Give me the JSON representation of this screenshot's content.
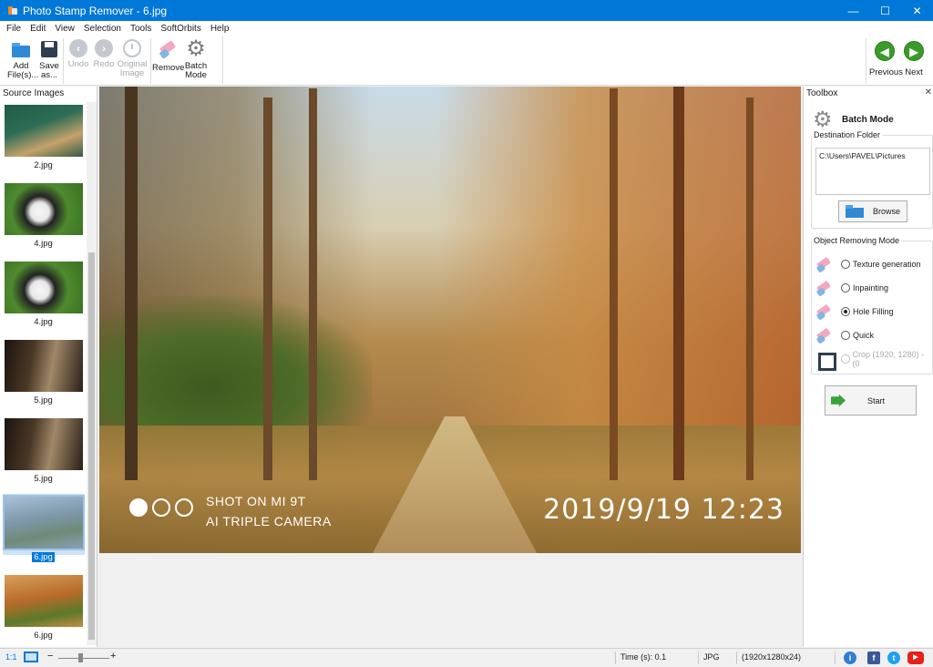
{
  "window": {
    "title": "Photo Stamp Remover - 6.jpg",
    "controls": {
      "minimize": "—",
      "maximize": "☐",
      "close": "✕"
    }
  },
  "menu": [
    "File",
    "Edit",
    "View",
    "Selection",
    "Tools",
    "SoftOrbits",
    "Help"
  ],
  "toolbar": {
    "add_files": "Add File(s)...",
    "save_as": "Save as...",
    "undo": "Undo",
    "redo": "Redo",
    "original_image": "Original Image",
    "remove": "Remove",
    "batch_mode": "Batch Mode",
    "previous": "Previous",
    "next": "Next"
  },
  "source_images": {
    "title": "Source Images",
    "items": [
      "2.jpg",
      "4.jpg",
      "4.jpg",
      "5.jpg",
      "5.jpg",
      "6.jpg",
      "6.jpg"
    ],
    "selected_index": 5
  },
  "photo_watermark": {
    "line1": "SHOT ON MI 9T",
    "line2": "AI TRIPLE CAMERA",
    "datetime": "2019/9/19  12:23"
  },
  "toolbox": {
    "title": "Toolbox",
    "close": "✕",
    "batch_mode_label": "Batch Mode",
    "destination_folder_label": "Destination Folder",
    "destination_path": "C:\\Users\\PAVEL\\Pictures",
    "browse": "Browse",
    "mode_group_label": "Object Removing Mode",
    "modes": [
      {
        "label": "Texture generation",
        "checked": false,
        "enabled": true
      },
      {
        "label": "Inpainting",
        "checked": false,
        "enabled": true
      },
      {
        "label": "Hole Filling",
        "checked": true,
        "enabled": true
      },
      {
        "label": "Quick",
        "checked": false,
        "enabled": true
      },
      {
        "label": "Crop (1920, 1280) - (0",
        "checked": false,
        "enabled": false
      }
    ],
    "start": "Start"
  },
  "statusbar": {
    "zoom_ratio": "1:1",
    "zoom_minus": "−",
    "zoom_plus": "+",
    "time": "Time (s): 0.1",
    "format": "JPG",
    "dimensions": "(1920x1280x24)",
    "info_icon": "i",
    "facebook_icon": "f",
    "twitter_icon": "t",
    "youtube_icon": "▶"
  },
  "colors": {
    "titlebar": "#0078d7",
    "selection": "#0078d7",
    "nav_green": "#3a9b2a"
  }
}
